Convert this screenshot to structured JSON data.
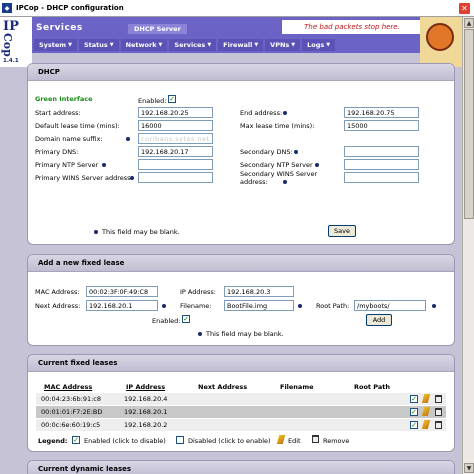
{
  "window": {
    "title": "IPCop - DHCP configuration"
  },
  "logo": {
    "ip": "IP",
    "cop": "Cop",
    "version": "1.4.1"
  },
  "header": {
    "section": "Services",
    "subtab": "DHCP Server",
    "slogan": "The bad packets stop here."
  },
  "nav": [
    "System",
    "Status",
    "Network",
    "Services",
    "Firewall",
    "VPNs",
    "Logs"
  ],
  "dhcp": {
    "title": "DHCP",
    "green_interface": "Green Interface",
    "enabled_label": "Enabled:",
    "start_label": "Start address:",
    "start_value": "192.168.20.25",
    "end_label": "End address:",
    "end_value": "192.168.20.75",
    "default_lease_label": "Default lease time (mins):",
    "default_lease_value": "16000",
    "max_lease_label": "Max lease time (mins):",
    "max_lease_value": "15000",
    "domain_label": "Domain name suffix:",
    "domain_value": "coribans.sytes.net",
    "primary_dns_label": "Primary DNS:",
    "primary_dns_value": "192.168.20.17",
    "secondary_dns_label": "Secondary DNS:",
    "primary_ntp_label": "Primary NTP Server",
    "secondary_ntp_label": "Secondary NTP Server",
    "primary_wins_label": "Primary WINS Server address:",
    "secondary_wins_label": "Secondary WINS Server address:",
    "blank_note": "This field may be blank.",
    "save_label": "Save"
  },
  "fixed": {
    "title": "Add a new fixed lease",
    "mac_label": "MAC Address:",
    "mac_value": "00:02:3F:0F:49:C8",
    "ip_label": "IP Address:",
    "ip_value": "192.168.20.3",
    "next_label": "Next Address:",
    "next_value": "192.168.20.1",
    "filename_label": "Filename:",
    "filename_value": "BootFile.img",
    "root_label": "Root Path:",
    "root_value": "/myboots/",
    "enabled_label": "Enabled:",
    "blank_note": "This field may be blank.",
    "add_label": "Add"
  },
  "current": {
    "title": "Current fixed leases",
    "headers": [
      "MAC Address",
      "IP Address",
      "Next Address",
      "Filename",
      "Root Path"
    ],
    "rows": [
      {
        "mac": "00:04:23:6b:91:c8",
        "ip": "192.168.20.4"
      },
      {
        "mac": "00:01:01:F7:2E:BD",
        "ip": "192.168.20.1"
      },
      {
        "mac": "00:0c:6e:60:19:c5",
        "ip": "192.168.20.2"
      }
    ],
    "legend_label": "Legend:",
    "legend_enabled": "Enabled (click to disable)",
    "legend_disabled": "Disabled (click to enable)",
    "legend_edit": "Edit",
    "legend_remove": "Remove"
  },
  "dynamic": {
    "title": "Current dynamic leases"
  }
}
